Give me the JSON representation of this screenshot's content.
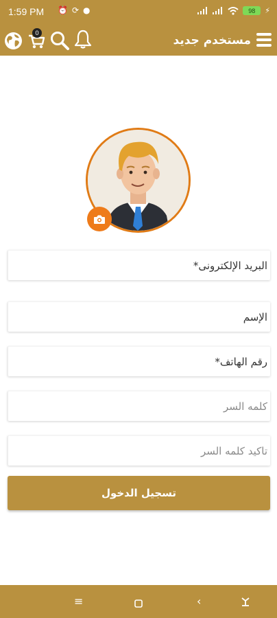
{
  "status_bar": {
    "time": "1:59 PM",
    "battery": "98",
    "left_icons": [
      "alarm-icon",
      "sync-icon",
      "app-icon"
    ],
    "right_icons": [
      "signal-icon",
      "signal-icon",
      "wifi-icon",
      "battery-icon",
      "charging-icon"
    ]
  },
  "app_bar": {
    "title": "مستخدم جديد",
    "cart_count": "0",
    "icons": [
      "menu-icon",
      "globe-icon",
      "cart-icon",
      "search-icon",
      "bell-icon"
    ]
  },
  "profile": {
    "avatar_icon": "user-avatar",
    "camera_icon": "camera-icon"
  },
  "form": {
    "email_placeholder": "البريد الإلكترونى*",
    "name_placeholder": "الإسم",
    "phone_placeholder": "رقم الهاتف*",
    "password_placeholder": "كلمه السر",
    "confirm_password_placeholder": "تاكيد كلمه السر",
    "submit_label": "تسجيل الدخول"
  },
  "nav_bar": {
    "icons": [
      "recents-icon",
      "home-icon",
      "back-icon",
      "assist-icon"
    ]
  },
  "colors": {
    "primary": "#b9913f",
    "accent": "#ee7b1a",
    "background": "#ffffff"
  }
}
